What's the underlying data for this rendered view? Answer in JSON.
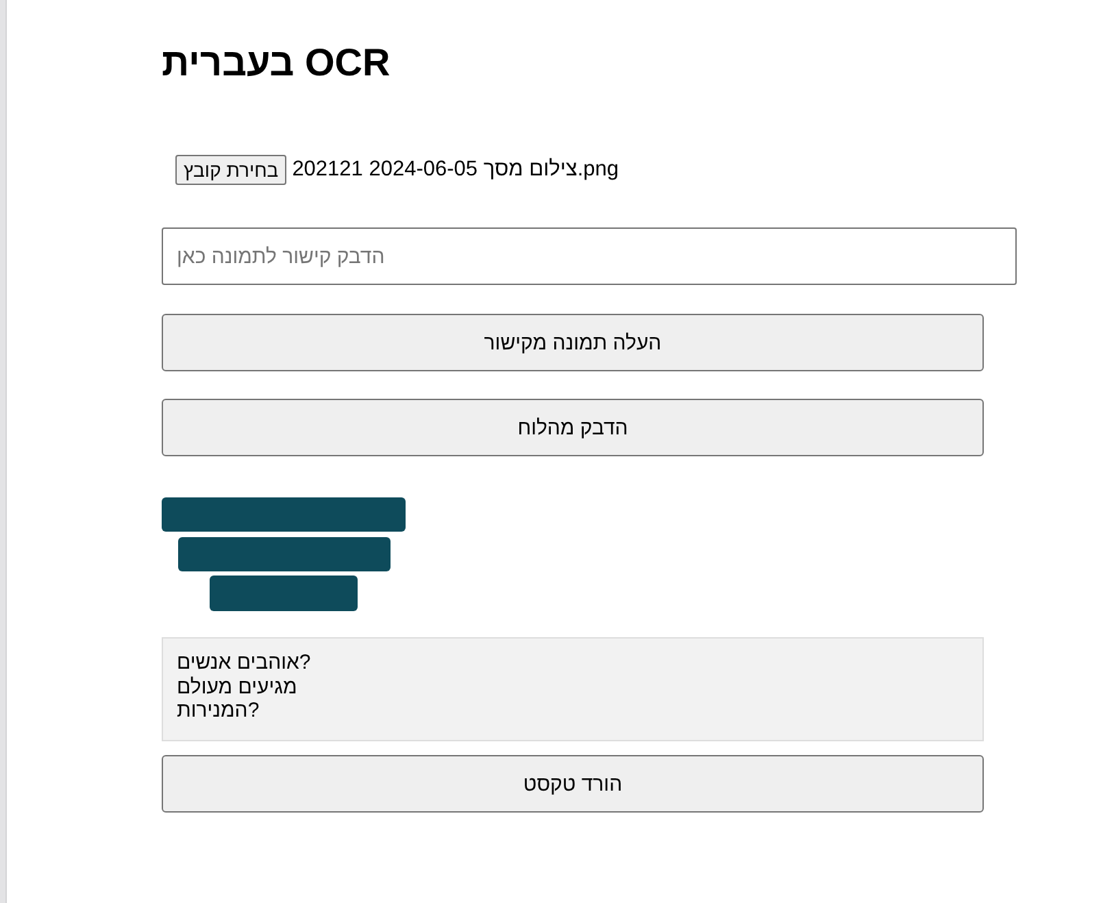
{
  "title": "בעברית OCR",
  "file_picker": {
    "button": "בחירת קובץ",
    "file_name": "צילום מסך 2024-06-05 202121.png"
  },
  "url_field": {
    "placeholder": "הדבק קישור לתמונה כאן"
  },
  "buttons": [
    {
      "label": "העלה תמונה מקישור"
    },
    {
      "label": "הדבק מהלוח"
    }
  ],
  "ocr_result": {
    "lines": [
      "אוהבים אנשים?",
      "מגיעים מעולם",
      "המנירות?"
    ]
  },
  "download_button": {
    "label": "הורד טקסט"
  }
}
